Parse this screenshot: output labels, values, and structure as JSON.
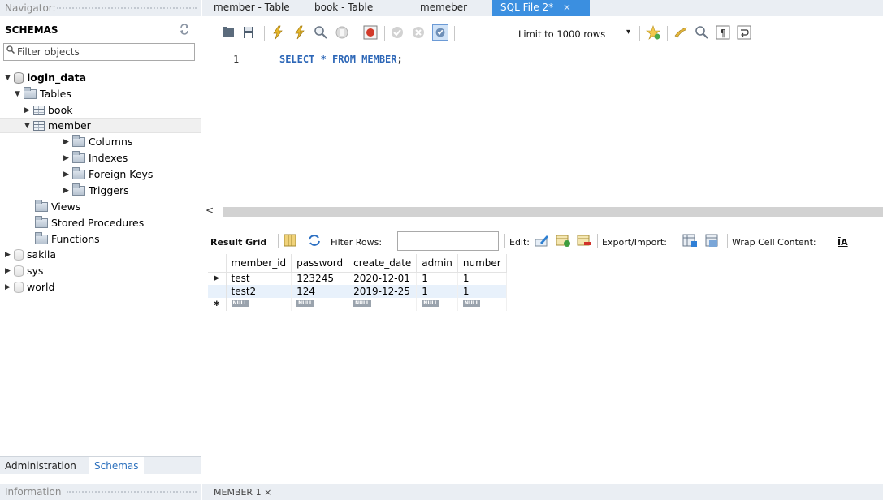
{
  "navigator": {
    "header": "Navigator:",
    "schemas_title": "SCHEMAS",
    "filter_placeholder": "Filter objects",
    "tree": [
      {
        "label": "login_data",
        "arrow": "▼"
      },
      {
        "label": "Tables",
        "arrow": "▼"
      },
      {
        "label": "book",
        "arrow": "▶"
      },
      {
        "label": "member",
        "arrow": "▼"
      },
      {
        "label": "Columns",
        "arrow": "▶"
      },
      {
        "label": "Indexes",
        "arrow": "▶"
      },
      {
        "label": "Foreign Keys",
        "arrow": "▶"
      },
      {
        "label": "Triggers",
        "arrow": "▶"
      },
      {
        "label": "Views",
        "arrow": ""
      },
      {
        "label": "Stored Procedures",
        "arrow": ""
      },
      {
        "label": "Functions",
        "arrow": ""
      },
      {
        "label": "sakila",
        "arrow": "▶"
      },
      {
        "label": "sys",
        "arrow": "▶"
      },
      {
        "label": "world",
        "arrow": "▶"
      }
    ],
    "bottom_tabs": [
      "Administration",
      "Schemas"
    ],
    "info_header": "Information"
  },
  "tabs": [
    {
      "label": "member - Table"
    },
    {
      "label": "book - Table"
    },
    {
      "label": "memeber"
    },
    {
      "label": "SQL File 2*",
      "close": "×"
    }
  ],
  "toolbar": {
    "limit_label": "Limit to 1000 rows",
    "caret": "▾"
  },
  "editor": {
    "line_number": "1",
    "sql_keyword_text": "SELECT * FROM MEMBER",
    "sql_terminator": ";"
  },
  "scroll": {
    "left_arrow": "<"
  },
  "result_toolbar": {
    "result_grid": "Result Grid",
    "filter_rows": "Filter Rows:",
    "edit": "Edit:",
    "export_import": "Export/Import:",
    "wrap_cell": "Wrap Cell Content:",
    "wrap_icon": "ĪA"
  },
  "grid": {
    "columns": [
      "member_id",
      "password",
      "create_date",
      "admin",
      "number"
    ],
    "rows": [
      {
        "marker": "▶",
        "cells": [
          "test",
          "123245",
          "2020-12-01",
          "1",
          "1"
        ]
      },
      {
        "marker": "",
        "cells": [
          "test2",
          "124",
          "2019-12-25",
          "1",
          "1"
        ]
      },
      {
        "marker": "✱",
        "cells": [
          "NULL",
          "NULL",
          "NULL",
          "NULL",
          "NULL"
        ]
      }
    ]
  },
  "result_tab": "MEMBER 1 ×"
}
